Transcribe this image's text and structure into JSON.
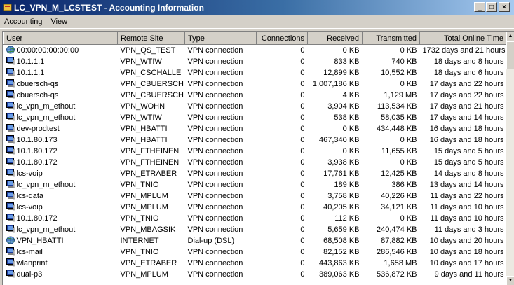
{
  "window": {
    "title": "LC_VPN_M_LCSTEST - Accounting Information"
  },
  "menu": [
    "Accounting",
    "View"
  ],
  "columns": [
    "User",
    "Remote Site",
    "Type",
    "Connections",
    "Received",
    "Transmitted",
    "Total Online Time"
  ],
  "rows": [
    {
      "icon": "globe-icon",
      "user": "00:00:00:00:00:00",
      "site": "VPN_QS_TEST",
      "type": "VPN connection",
      "conn": "0",
      "recv": "0 KB",
      "sent": "0 KB",
      "time": "1732 days and 21 hours"
    },
    {
      "icon": "computer-icon",
      "user": "10.1.1.1",
      "site": "VPN_WTIW",
      "type": "VPN connection",
      "conn": "0",
      "recv": "833 KB",
      "sent": "740 KB",
      "time": "18 days and 8 hours"
    },
    {
      "icon": "computer-icon",
      "user": "10.1.1.1",
      "site": "VPN_CSCHALLE",
      "type": "VPN connection",
      "conn": "0",
      "recv": "12,899 KB",
      "sent": "10,552 KB",
      "time": "18 days and 6 hours"
    },
    {
      "icon": "computer-icon",
      "user": "cbuersch-qs",
      "site": "VPN_CBUERSCH",
      "type": "VPN connection",
      "conn": "0",
      "recv": "1,007,186 KB",
      "sent": "0 KB",
      "time": "17 days and 22 hours"
    },
    {
      "icon": "computer-icon",
      "user": "cbuersch-qs",
      "site": "VPN_CBUERSCH",
      "type": "VPN connection",
      "conn": "0",
      "recv": "4 KB",
      "sent": "1,129 MB",
      "time": "17 days and 22 hours"
    },
    {
      "icon": "computer-icon",
      "user": "lc_vpn_m_ethout",
      "site": "VPN_WOHN",
      "type": "VPN connection",
      "conn": "0",
      "recv": "3,904 KB",
      "sent": "113,534 KB",
      "time": "17 days and 21 hours"
    },
    {
      "icon": "computer-icon",
      "user": "lc_vpn_m_ethout",
      "site": "VPN_WTIW",
      "type": "VPN connection",
      "conn": "0",
      "recv": "538 KB",
      "sent": "58,035 KB",
      "time": "17 days and 14 hours"
    },
    {
      "icon": "computer-icon",
      "user": "dev-prodtest",
      "site": "VPN_HBATTI",
      "type": "VPN connection",
      "conn": "0",
      "recv": "0 KB",
      "sent": "434,448 KB",
      "time": "16 days and 18 hours"
    },
    {
      "icon": "computer-icon",
      "user": "10.1.80.173",
      "site": "VPN_HBATTI",
      "type": "VPN connection",
      "conn": "0",
      "recv": "467,340 KB",
      "sent": "0 KB",
      "time": "16 days and 18 hours"
    },
    {
      "icon": "computer-icon",
      "user": "10.1.80.172",
      "site": "VPN_FTHEINEN",
      "type": "VPN connection",
      "conn": "0",
      "recv": "0 KB",
      "sent": "11,655 KB",
      "time": "15 days and 5 hours"
    },
    {
      "icon": "computer-icon",
      "user": "10.1.80.172",
      "site": "VPN_FTHEINEN",
      "type": "VPN connection",
      "conn": "0",
      "recv": "3,938 KB",
      "sent": "0 KB",
      "time": "15 days and 5 hours"
    },
    {
      "icon": "computer-icon",
      "user": "lcs-voip",
      "site": "VPN_ETRABER",
      "type": "VPN connection",
      "conn": "0",
      "recv": "17,761 KB",
      "sent": "12,425 KB",
      "time": "14 days and 8 hours"
    },
    {
      "icon": "computer-icon",
      "user": "lc_vpn_m_ethout",
      "site": "VPN_TNIO",
      "type": "VPN connection",
      "conn": "0",
      "recv": "189 KB",
      "sent": "386 KB",
      "time": "13 days and 14 hours"
    },
    {
      "icon": "computer-icon",
      "user": "lcs-data",
      "site": "VPN_MPLUM",
      "type": "VPN connection",
      "conn": "0",
      "recv": "3,758 KB",
      "sent": "40,226 KB",
      "time": "11 days and 22 hours"
    },
    {
      "icon": "computer-icon",
      "user": "lcs-voip",
      "site": "VPN_MPLUM",
      "type": "VPN connection",
      "conn": "0",
      "recv": "40,205 KB",
      "sent": "34,121 KB",
      "time": "11 days and 10 hours"
    },
    {
      "icon": "computer-icon",
      "user": "10.1.80.172",
      "site": "VPN_TNIO",
      "type": "VPN connection",
      "conn": "0",
      "recv": "112 KB",
      "sent": "0 KB",
      "time": "11 days and 10 hours"
    },
    {
      "icon": "computer-icon",
      "user": "lc_vpn_m_ethout",
      "site": "VPN_MBAGSIK",
      "type": "VPN connection",
      "conn": "0",
      "recv": "5,659 KB",
      "sent": "240,474 KB",
      "time": "11 days and 3 hours"
    },
    {
      "icon": "globe-icon",
      "user": "VPN_HBATTI",
      "site": "INTERNET",
      "type": "Dial-up (DSL)",
      "conn": "0",
      "recv": "68,508 KB",
      "sent": "87,882 KB",
      "time": "10 days and 20 hours"
    },
    {
      "icon": "computer-icon",
      "user": "lcs-mail",
      "site": "VPN_TNIO",
      "type": "VPN connection",
      "conn": "0",
      "recv": "82,152 KB",
      "sent": "286,546 KB",
      "time": "10 days and 18 hours"
    },
    {
      "icon": "computer-icon",
      "user": "wlanprint",
      "site": "VPN_ETRABER",
      "type": "VPN connection",
      "conn": "0",
      "recv": "443,863 KB",
      "sent": "1,658 MB",
      "time": "10 days and 17 hours"
    },
    {
      "icon": "computer-icon",
      "user": "dual-p3",
      "site": "VPN_MPLUM",
      "type": "VPN connection",
      "conn": "0",
      "recv": "389,063 KB",
      "sent": "536,872 KB",
      "time": "9 days and 11 hours"
    }
  ]
}
